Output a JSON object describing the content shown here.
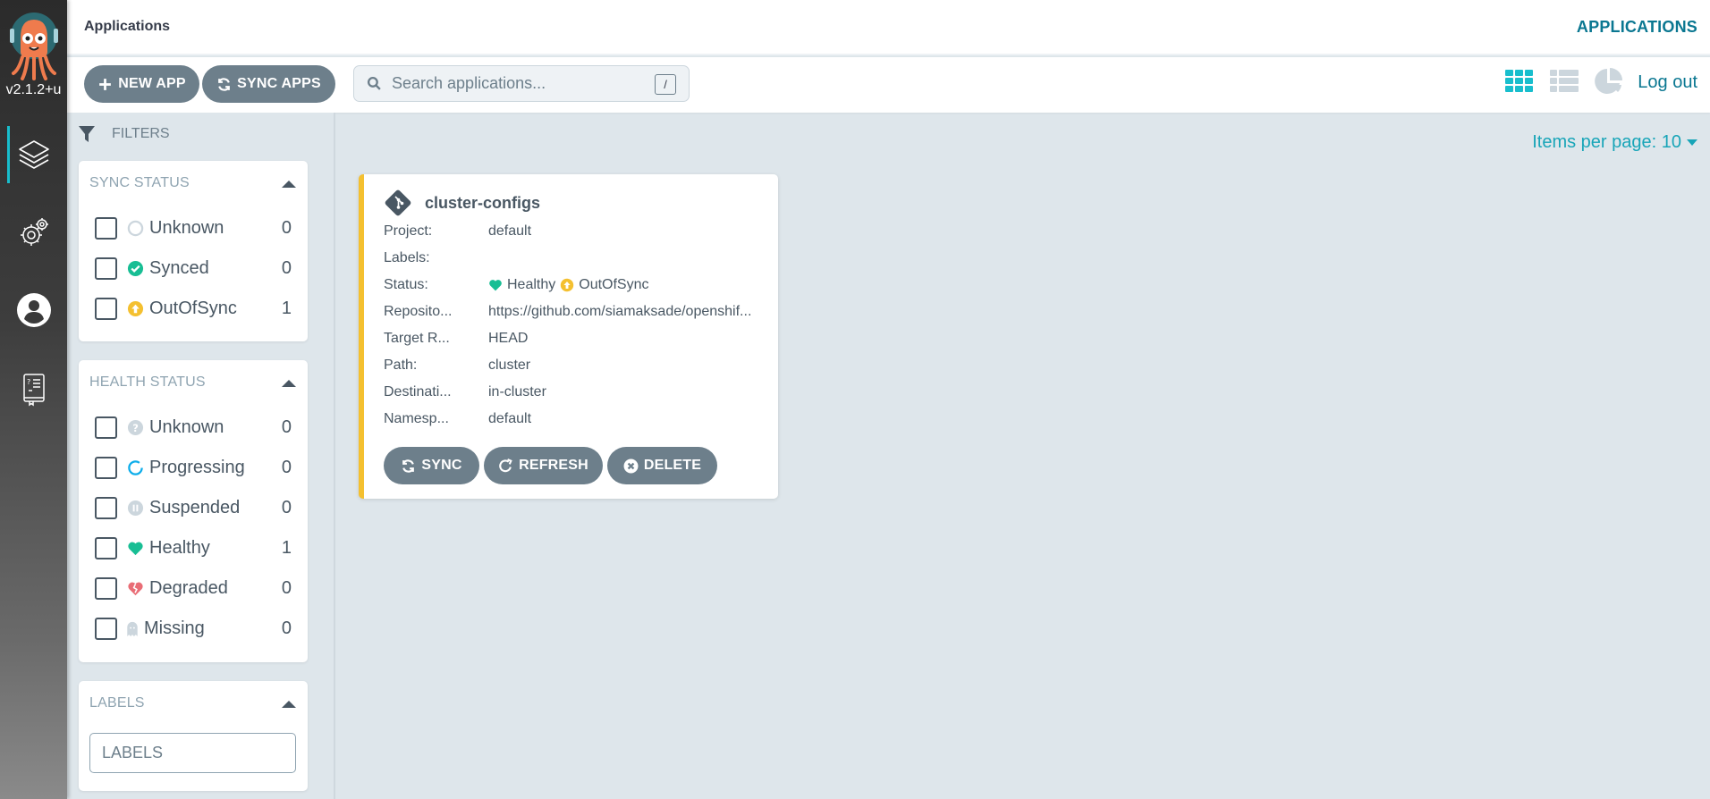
{
  "nav": {
    "version": "v2.1.2+u",
    "items": [
      {
        "name": "applications",
        "active": true
      },
      {
        "name": "settings",
        "active": false
      },
      {
        "name": "user-info",
        "active": false
      },
      {
        "name": "documentation",
        "active": false
      }
    ]
  },
  "header": {
    "title": "Applications",
    "section_link": "APPLICATIONS"
  },
  "toolbar": {
    "new_app_label": "NEW APP",
    "sync_apps_label": "SYNC APPS",
    "search_placeholder": "Search applications...",
    "search_value": "",
    "search_shortcut": "/",
    "views": [
      "tiles",
      "list",
      "summary"
    ],
    "active_view": "tiles",
    "logout_label": "Log out"
  },
  "filters": {
    "title": "FILTERS",
    "sync_status": {
      "title": "SYNC STATUS",
      "items": [
        {
          "label": "Unknown",
          "count": "0",
          "icon": "unknown-circle-icon",
          "checked": false
        },
        {
          "label": "Synced",
          "count": "0",
          "icon": "check-circle-icon",
          "checked": false
        },
        {
          "label": "OutOfSync",
          "count": "1",
          "icon": "arrow-up-circle-icon",
          "checked": false
        }
      ]
    },
    "health_status": {
      "title": "HEALTH STATUS",
      "items": [
        {
          "label": "Unknown",
          "count": "0",
          "icon": "question-circle-icon",
          "checked": false
        },
        {
          "label": "Progressing",
          "count": "0",
          "icon": "spinner-icon",
          "checked": false
        },
        {
          "label": "Suspended",
          "count": "0",
          "icon": "pause-circle-icon",
          "checked": false
        },
        {
          "label": "Healthy",
          "count": "1",
          "icon": "heart-icon",
          "checked": false
        },
        {
          "label": "Degraded",
          "count": "0",
          "icon": "broken-heart-icon",
          "checked": false
        },
        {
          "label": "Missing",
          "count": "0",
          "icon": "ghost-icon",
          "checked": false
        }
      ]
    },
    "labels": {
      "title": "LABELS",
      "placeholder": "LABELS",
      "value": ""
    }
  },
  "pagination": {
    "items_per_page_label": "Items per page: 10"
  },
  "applications": [
    {
      "name": "cluster-configs",
      "fields": [
        {
          "key": "Project:",
          "value": "default"
        },
        {
          "key": "Labels:",
          "value": ""
        },
        {
          "key": "Status:",
          "health": "Healthy",
          "sync": "OutOfSync"
        },
        {
          "key": "Reposito...",
          "value": "https://github.com/siamaksade/openshif..."
        },
        {
          "key": "Target R...",
          "value": "HEAD"
        },
        {
          "key": "Path:",
          "value": "cluster"
        },
        {
          "key": "Destinati...",
          "value": "in-cluster"
        },
        {
          "key": "Namesp...",
          "value": "default"
        }
      ],
      "actions": {
        "sync": "SYNC",
        "refresh": "REFRESH",
        "delete": "DELETE"
      }
    }
  ],
  "colors": {
    "accent": "#18becd",
    "link": "#0a7791",
    "button": "#6d7f8b",
    "healthy": "#18be94",
    "out_of_sync": "#f4c030",
    "degraded": "#e96d76",
    "progressing": "#0dadea",
    "muted": "#ccd6dd"
  }
}
